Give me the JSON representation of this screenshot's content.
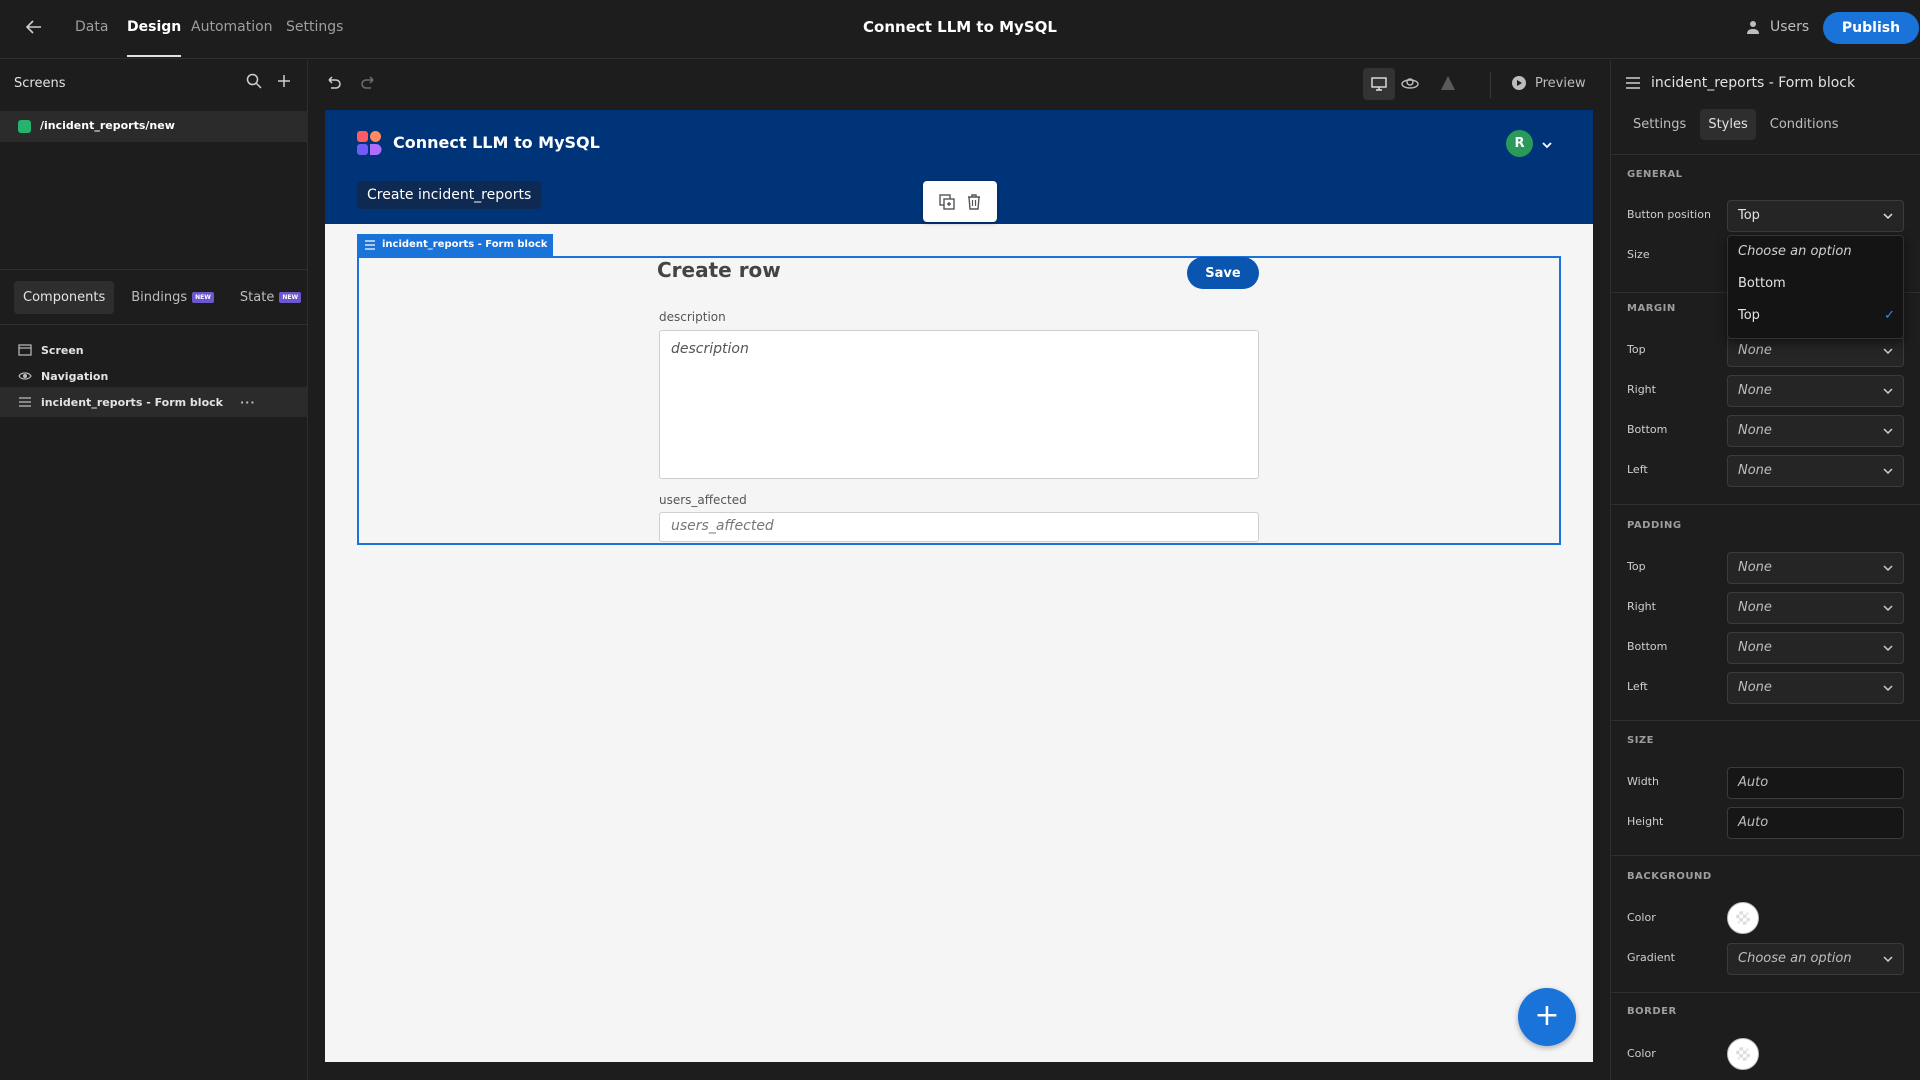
{
  "topbar": {
    "tabs": [
      "Data",
      "Design",
      "Automation",
      "Settings"
    ],
    "title": "Connect LLM to MySQL",
    "users_label": "Users",
    "publish_label": "Publish"
  },
  "left": {
    "screens_title": "Screens",
    "screen_route": "/incident_reports/new",
    "tabs": {
      "components": "Components",
      "bindings": "Bindings",
      "state": "State",
      "new_badge": "NEW"
    },
    "tree": [
      "Screen",
      "Navigation",
      "incident_reports - Form block"
    ],
    "more": "···"
  },
  "toolbar": {
    "preview_label": "Preview"
  },
  "canvas": {
    "app_name": "Connect LLM to MySQL",
    "avatar_initial": "R",
    "breadcrumb": "Create incident_reports",
    "form_tag": "incident_reports - Form block",
    "form_title": "Create row",
    "save_label": "Save",
    "fields": [
      {
        "label": "description",
        "placeholder": "description"
      },
      {
        "label": "users_affected",
        "placeholder": "users_affected"
      }
    ],
    "fab": "+"
  },
  "right": {
    "title": "incident_reports - Form block",
    "tabs": [
      "Settings",
      "Styles",
      "Conditions"
    ],
    "general": {
      "heading": "GENERAL",
      "button_position_label": "Button position",
      "button_position_value": "Top",
      "size_label": "Size",
      "options": [
        "Choose an option",
        "Bottom",
        "Top"
      ],
      "selected_option": "Top"
    },
    "margin": {
      "heading": "MARGIN",
      "rows": [
        {
          "label": "Top",
          "value": "None"
        },
        {
          "label": "Right",
          "value": "None"
        },
        {
          "label": "Bottom",
          "value": "None"
        },
        {
          "label": "Left",
          "value": "None"
        }
      ]
    },
    "padding": {
      "heading": "PADDING",
      "rows": [
        {
          "label": "Top",
          "value": "None"
        },
        {
          "label": "Right",
          "value": "None"
        },
        {
          "label": "Bottom",
          "value": "None"
        },
        {
          "label": "Left",
          "value": "None"
        }
      ]
    },
    "size": {
      "heading": "SIZE",
      "width_label": "Width",
      "width_value": "Auto",
      "height_label": "Height",
      "height_value": "Auto"
    },
    "background": {
      "heading": "BACKGROUND",
      "color_label": "Color",
      "gradient_label": "Gradient",
      "gradient_value": "Choose an option"
    },
    "border": {
      "heading": "BORDER",
      "color_label": "Color"
    }
  },
  "colors": {
    "accent": "#1a73d9",
    "app_header": "#003479",
    "screen_dot": "#25b36f",
    "avatar": "#2a9a5a"
  }
}
